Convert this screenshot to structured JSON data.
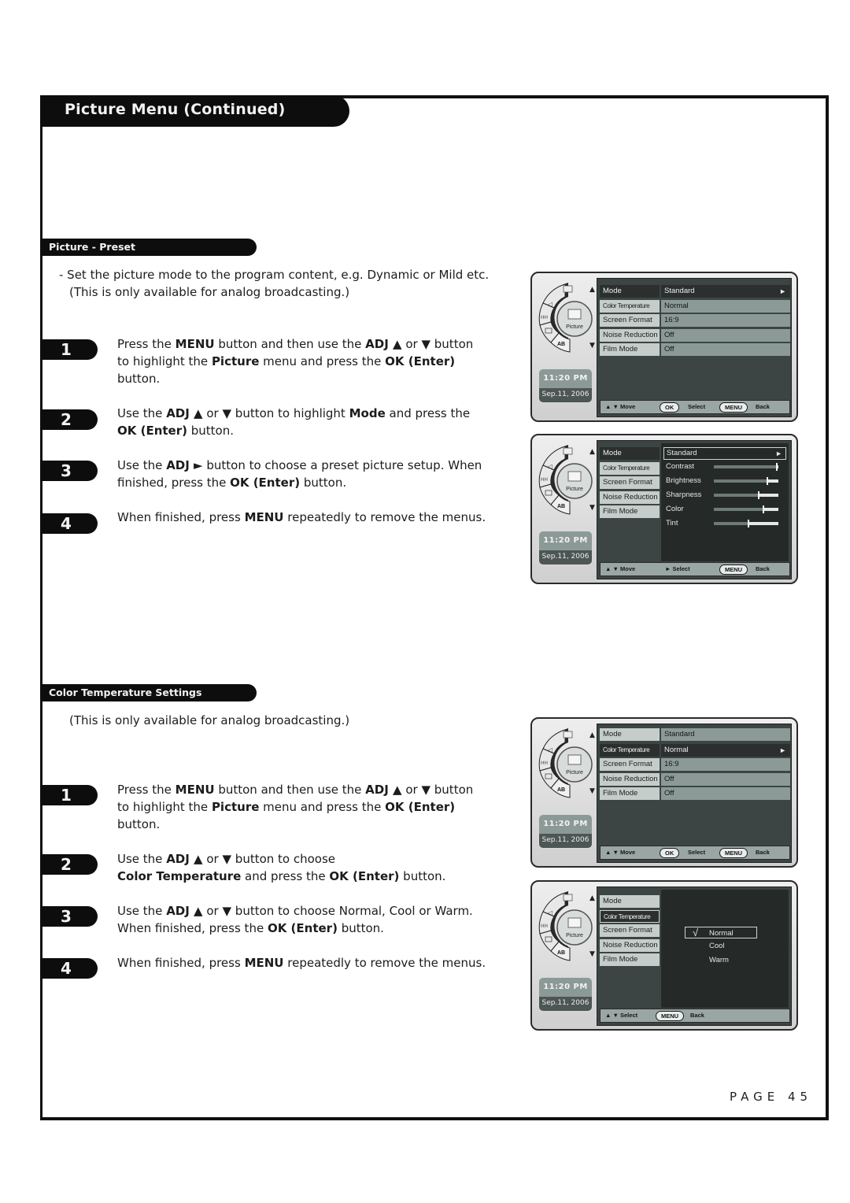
{
  "page": {
    "title": "Picture Menu (Continued)",
    "page_label": "PAGE 45"
  },
  "sections": [
    {
      "heading": "Picture - Preset",
      "intro_line1": "- Set the picture mode to the program content, e.g. Dynamic or Mild etc.",
      "intro_line2": "(This is only available for analog broadcasting.)",
      "steps": [
        {
          "number": "1",
          "text_html": "Press the <b>MENU</b> button and then use the <b>ADJ ▲</b> or <b>▼</b> button to highlight the <b>Picture</b> menu and press the <b>OK (Enter)</b> button."
        },
        {
          "number": "2",
          "text_html": "Use the <b>ADJ ▲</b> or <b>▼</b> button to highlight <b>Mode</b> and press the <b>OK (Enter)</b> button."
        },
        {
          "number": "3",
          "text_html": "Use the <b>ADJ ►</b> button to choose a preset picture setup. When finished, press the <b>OK (Enter)</b> button."
        },
        {
          "number": "4",
          "text_html": "When finished, press <b>MENU</b> repeatedly to remove the menus."
        }
      ]
    },
    {
      "heading": "Color Temperature Settings",
      "intro_line1": "(This is only available for analog broadcasting.)",
      "steps": [
        {
          "number": "1",
          "text_html": "Press the <b>MENU</b> button and then use the <b>ADJ ▲</b> or <b>▼</b> button to highlight the <b>Picture</b> menu and press the <b>OK (Enter)</b> button."
        },
        {
          "number": "2",
          "text_html": "Use the <b>ADJ ▲</b> or <b>▼</b> button to choose<br><b>Color Temperature</b> and press the <b>OK (Enter)</b> button."
        },
        {
          "number": "3",
          "text_html": "Use the <b>ADJ ▲</b> or <b>▼</b> button to choose Normal, Cool or Warm. When finished, press the <b>OK (Enter)</b> button."
        },
        {
          "number": "4",
          "text_html": "When finished, press <b>MENU</b> repeatedly to remove the menus."
        }
      ]
    }
  ],
  "osd": {
    "wheel_label": "Picture",
    "wheel_icons": [
      "screen-icon",
      "speaker-icon",
      "antenna-icon",
      "timer-icon",
      "ab-icon"
    ],
    "ab_label": "AB",
    "up_arrow": "▲",
    "down_arrow": "▼",
    "time": "11:20 PM",
    "date": "Sep.11, 2006",
    "menu_items": [
      {
        "label": "Mode",
        "value": "Standard"
      },
      {
        "label": "Color Temperature",
        "value": "Normal"
      },
      {
        "label": "Screen Format",
        "value": "16:9"
      },
      {
        "label": "Noise Reduction",
        "value": "Off"
      },
      {
        "label": "Film Mode",
        "value": "Off"
      }
    ],
    "arrow": "►",
    "footer": {
      "move": "▲ ▼ Move",
      "ok": "OK",
      "select": "Select",
      "select_arrow": "► Select",
      "updown_select": "▲ ▼ Select",
      "menu": "MENU",
      "back": "Back"
    },
    "preset_submenu": {
      "selected": "Standard",
      "sliders": [
        {
          "label": "Contrast",
          "value": 98
        },
        {
          "label": "Brightness",
          "value": 83
        },
        {
          "label": "Sharpness",
          "value": 70
        },
        {
          "label": "Color",
          "value": 77
        },
        {
          "label": "Tint",
          "value": 54
        }
      ]
    },
    "color_temp_options": {
      "check": "√",
      "options": [
        "Normal",
        "Cool",
        "Warm"
      ],
      "selected": "Normal"
    }
  }
}
